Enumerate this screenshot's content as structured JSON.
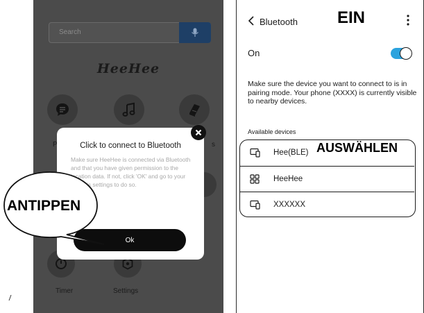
{
  "left_phone": {
    "search": {
      "placeholder": "Search",
      "icon": "mic-icon"
    },
    "brand": "HeeHee",
    "menu_icons": [
      "chat-icon",
      "music-note-icon",
      "book-icon",
      "timer-icon",
      "settings-icon"
    ],
    "labels": {
      "left_cutoff": "P",
      "right_cutoff": "s",
      "timer": "Timer",
      "settings": "Settings"
    },
    "dialog": {
      "title": "Click to connect to Bluetooth",
      "body": "Make sure HeeHee is connected via Bluetooth and that you have given permission to the location data. If not, click 'OK' and go to your phone's settings to do so.",
      "ok_label": "Ok",
      "close_icon": "close-icon"
    },
    "callout": "ANTIPPEN"
  },
  "right_phone": {
    "header": {
      "title": "Bluetooth",
      "back_icon": "chevron-left-icon",
      "more_icon": "more-vertical-icon"
    },
    "toggle": {
      "label": "On",
      "state": true,
      "color": "#2ba3de"
    },
    "info_text": "Make sure the device you want to connect to is in pairing mode. Your phone (XXXX) is currently visible to nearby devices.",
    "section_label": "Available devices",
    "devices": [
      {
        "name": "Hee(BLE)",
        "icon": "devices-icon"
      },
      {
        "name": "HeeHee",
        "icon": "grid-icon"
      },
      {
        "name": "XXXXXX",
        "icon": "devices-icon"
      }
    ],
    "callouts": {
      "toggle": "EIN",
      "select": "AUSWÄHLEN"
    }
  },
  "colors": {
    "overlay": "#4b4b4b",
    "accent": "#2ba3de",
    "mic": "#1e3f66"
  }
}
